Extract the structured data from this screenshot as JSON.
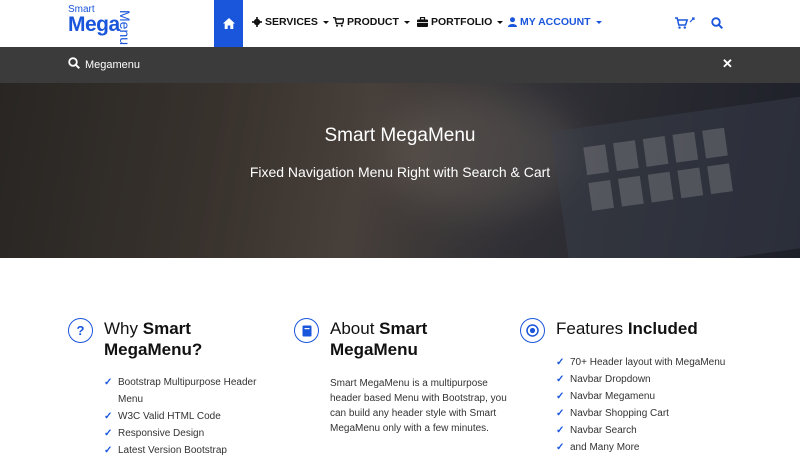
{
  "brand": {
    "line1": "Smart",
    "line2": "Mega",
    "line3": "Menu"
  },
  "nav": {
    "items": [
      {
        "label": "SERVICES",
        "icon": "gear-icon"
      },
      {
        "label": "PRODUCT",
        "icon": "cart-icon"
      },
      {
        "label": "PORTFOLIO",
        "icon": "briefcase-icon"
      },
      {
        "label": "MY ACCOUNT",
        "icon": "user-icon"
      }
    ]
  },
  "search": {
    "value": "Megamenu"
  },
  "hero": {
    "title": "Smart MegaMenu",
    "subtitle": "Fixed Navigation Menu Right with Search & Cart"
  },
  "col1": {
    "title_plain": "Why ",
    "title_bold": "Smart",
    "title_line2": "MegaMenu?",
    "items": [
      "Bootstrap Multipurpose Header Menu",
      "W3C Valid HTML Code",
      "Responsive Design",
      "Latest Version Bootstrap"
    ]
  },
  "col2": {
    "title_plain": "About ",
    "title_bold": "Smart",
    "title_line2": "MegaMenu",
    "text": "Smart MegaMenu is a multipurpose header based Menu with Bootstrap, you can build any header style with Smart MegaMenu only with a few minutes."
  },
  "col3": {
    "title_plain": "Features ",
    "title_bold": "Included",
    "items": [
      "70+ Header layout with MegaMenu",
      "Navbar Dropdown",
      "Navbar Megamenu",
      "Navbar Shopping Cart",
      "Navbar Search",
      "and Many More"
    ]
  },
  "colors": {
    "accent": "#1a56db",
    "searchbar": "#3b3b3b"
  }
}
